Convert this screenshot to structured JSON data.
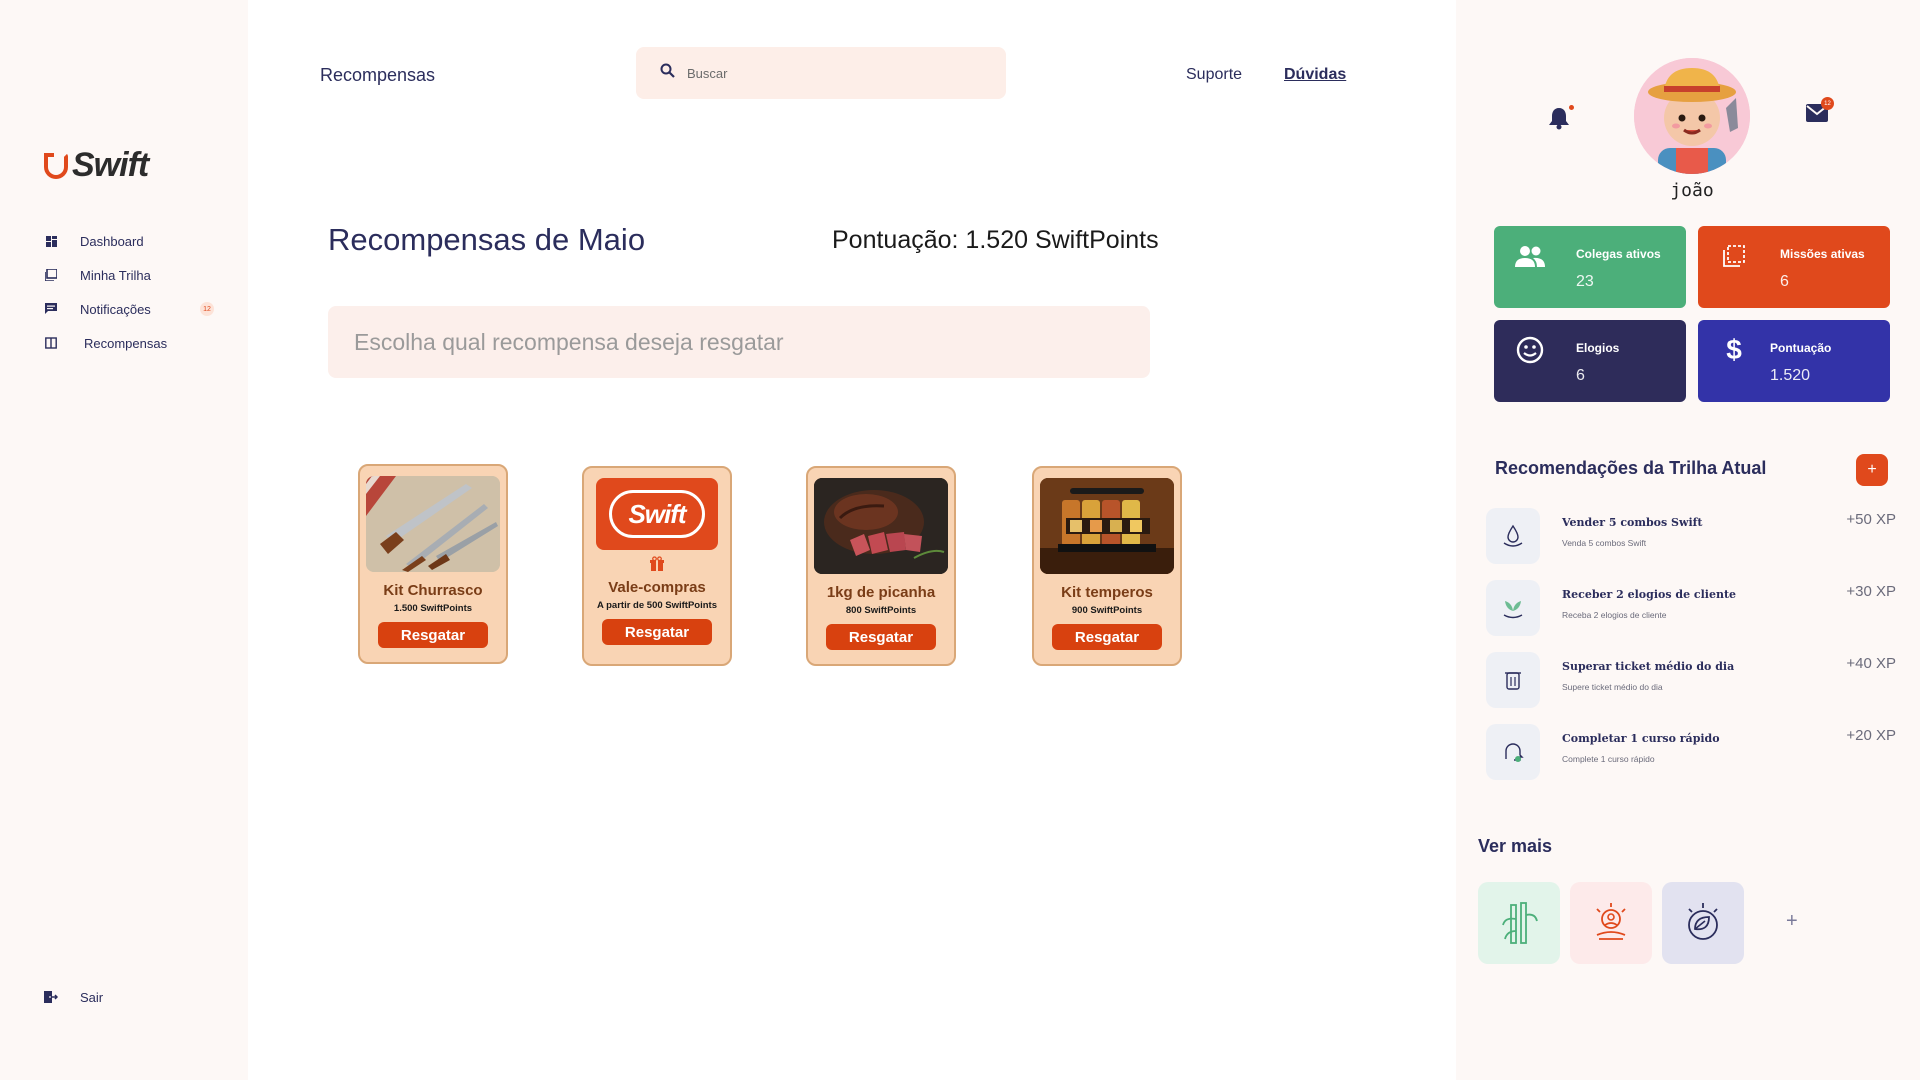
{
  "app": {
    "logo_text": "Swift"
  },
  "sidebar": {
    "items": [
      {
        "label": "Dashboard",
        "icon": "dashboard-icon"
      },
      {
        "label": "Minha Trilha",
        "icon": "trail-icon"
      },
      {
        "label": "Notificações",
        "icon": "chat-icon",
        "badge": "12"
      },
      {
        "label": "Recompensas",
        "icon": "book-icon"
      }
    ],
    "logout_label": "Sair"
  },
  "header": {
    "title": "Recompensas",
    "search_placeholder": "Buscar",
    "support_label": "Suporte",
    "faq_label": "Dúvidas"
  },
  "main": {
    "title": "Recompensas de Maio",
    "score": "Pontuação: 1.520 SwiftPoints",
    "choose_text": "Escolha qual recompensa deseja resgatar",
    "rewards": [
      {
        "name": "Kit Churrasco",
        "points": "1.500 SwiftPoints",
        "button": "Resgatar"
      },
      {
        "name": "Vale-compras",
        "points": "A partir de 500 SwiftPoints",
        "button": "Resgatar",
        "logo_text": "Swift"
      },
      {
        "name": "1kg de picanha",
        "points": "800 SwiftPoints",
        "button": "Resgatar"
      },
      {
        "name": "Kit temperos",
        "points": "900 SwiftPoints",
        "button": "Resgatar"
      }
    ]
  },
  "profile": {
    "username": "joão",
    "mail_badge": "12"
  },
  "stats": [
    {
      "label": "Colegas ativos",
      "value": "23",
      "color": "#4caf7a",
      "icon": "people-icon"
    },
    {
      "label": "Missões ativas",
      "value": "6",
      "color": "#e0491c",
      "icon": "missions-icon"
    },
    {
      "label": "Elogios",
      "value": "6",
      "color": "#2e2c5a",
      "icon": "smiley-icon"
    },
    {
      "label": "Pontuação",
      "value": "1.520",
      "color": "#3333a8",
      "icon": "dollar-icon"
    }
  ],
  "recommendations": {
    "title": "Recomendações da Trilha Atual",
    "items": [
      {
        "title": "Vender 5 combos Swift",
        "subtitle": "Venda 5 combos Swift",
        "xp": "+50 XP"
      },
      {
        "title": "Receber 2 elogios de cliente",
        "subtitle": "Receba 2 elogios de cliente",
        "xp": "+30 XP"
      },
      {
        "title": "Superar ticket médio do dia",
        "subtitle": "Supere ticket médio do dia",
        "xp": "+40 XP"
      },
      {
        "title": "Completar 1 curso rápido",
        "subtitle": "Complete 1 curso rápido",
        "xp": "+20 XP"
      }
    ]
  },
  "more": {
    "title": "Ver mais",
    "tiles": [
      {
        "icon": "bamboo-icon",
        "color": "#e2f4ea"
      },
      {
        "icon": "meditation-icon",
        "color": "#fdeaea"
      },
      {
        "icon": "leaf-globe-icon",
        "color": "#e2e2f0"
      }
    ],
    "add_label": "+"
  }
}
